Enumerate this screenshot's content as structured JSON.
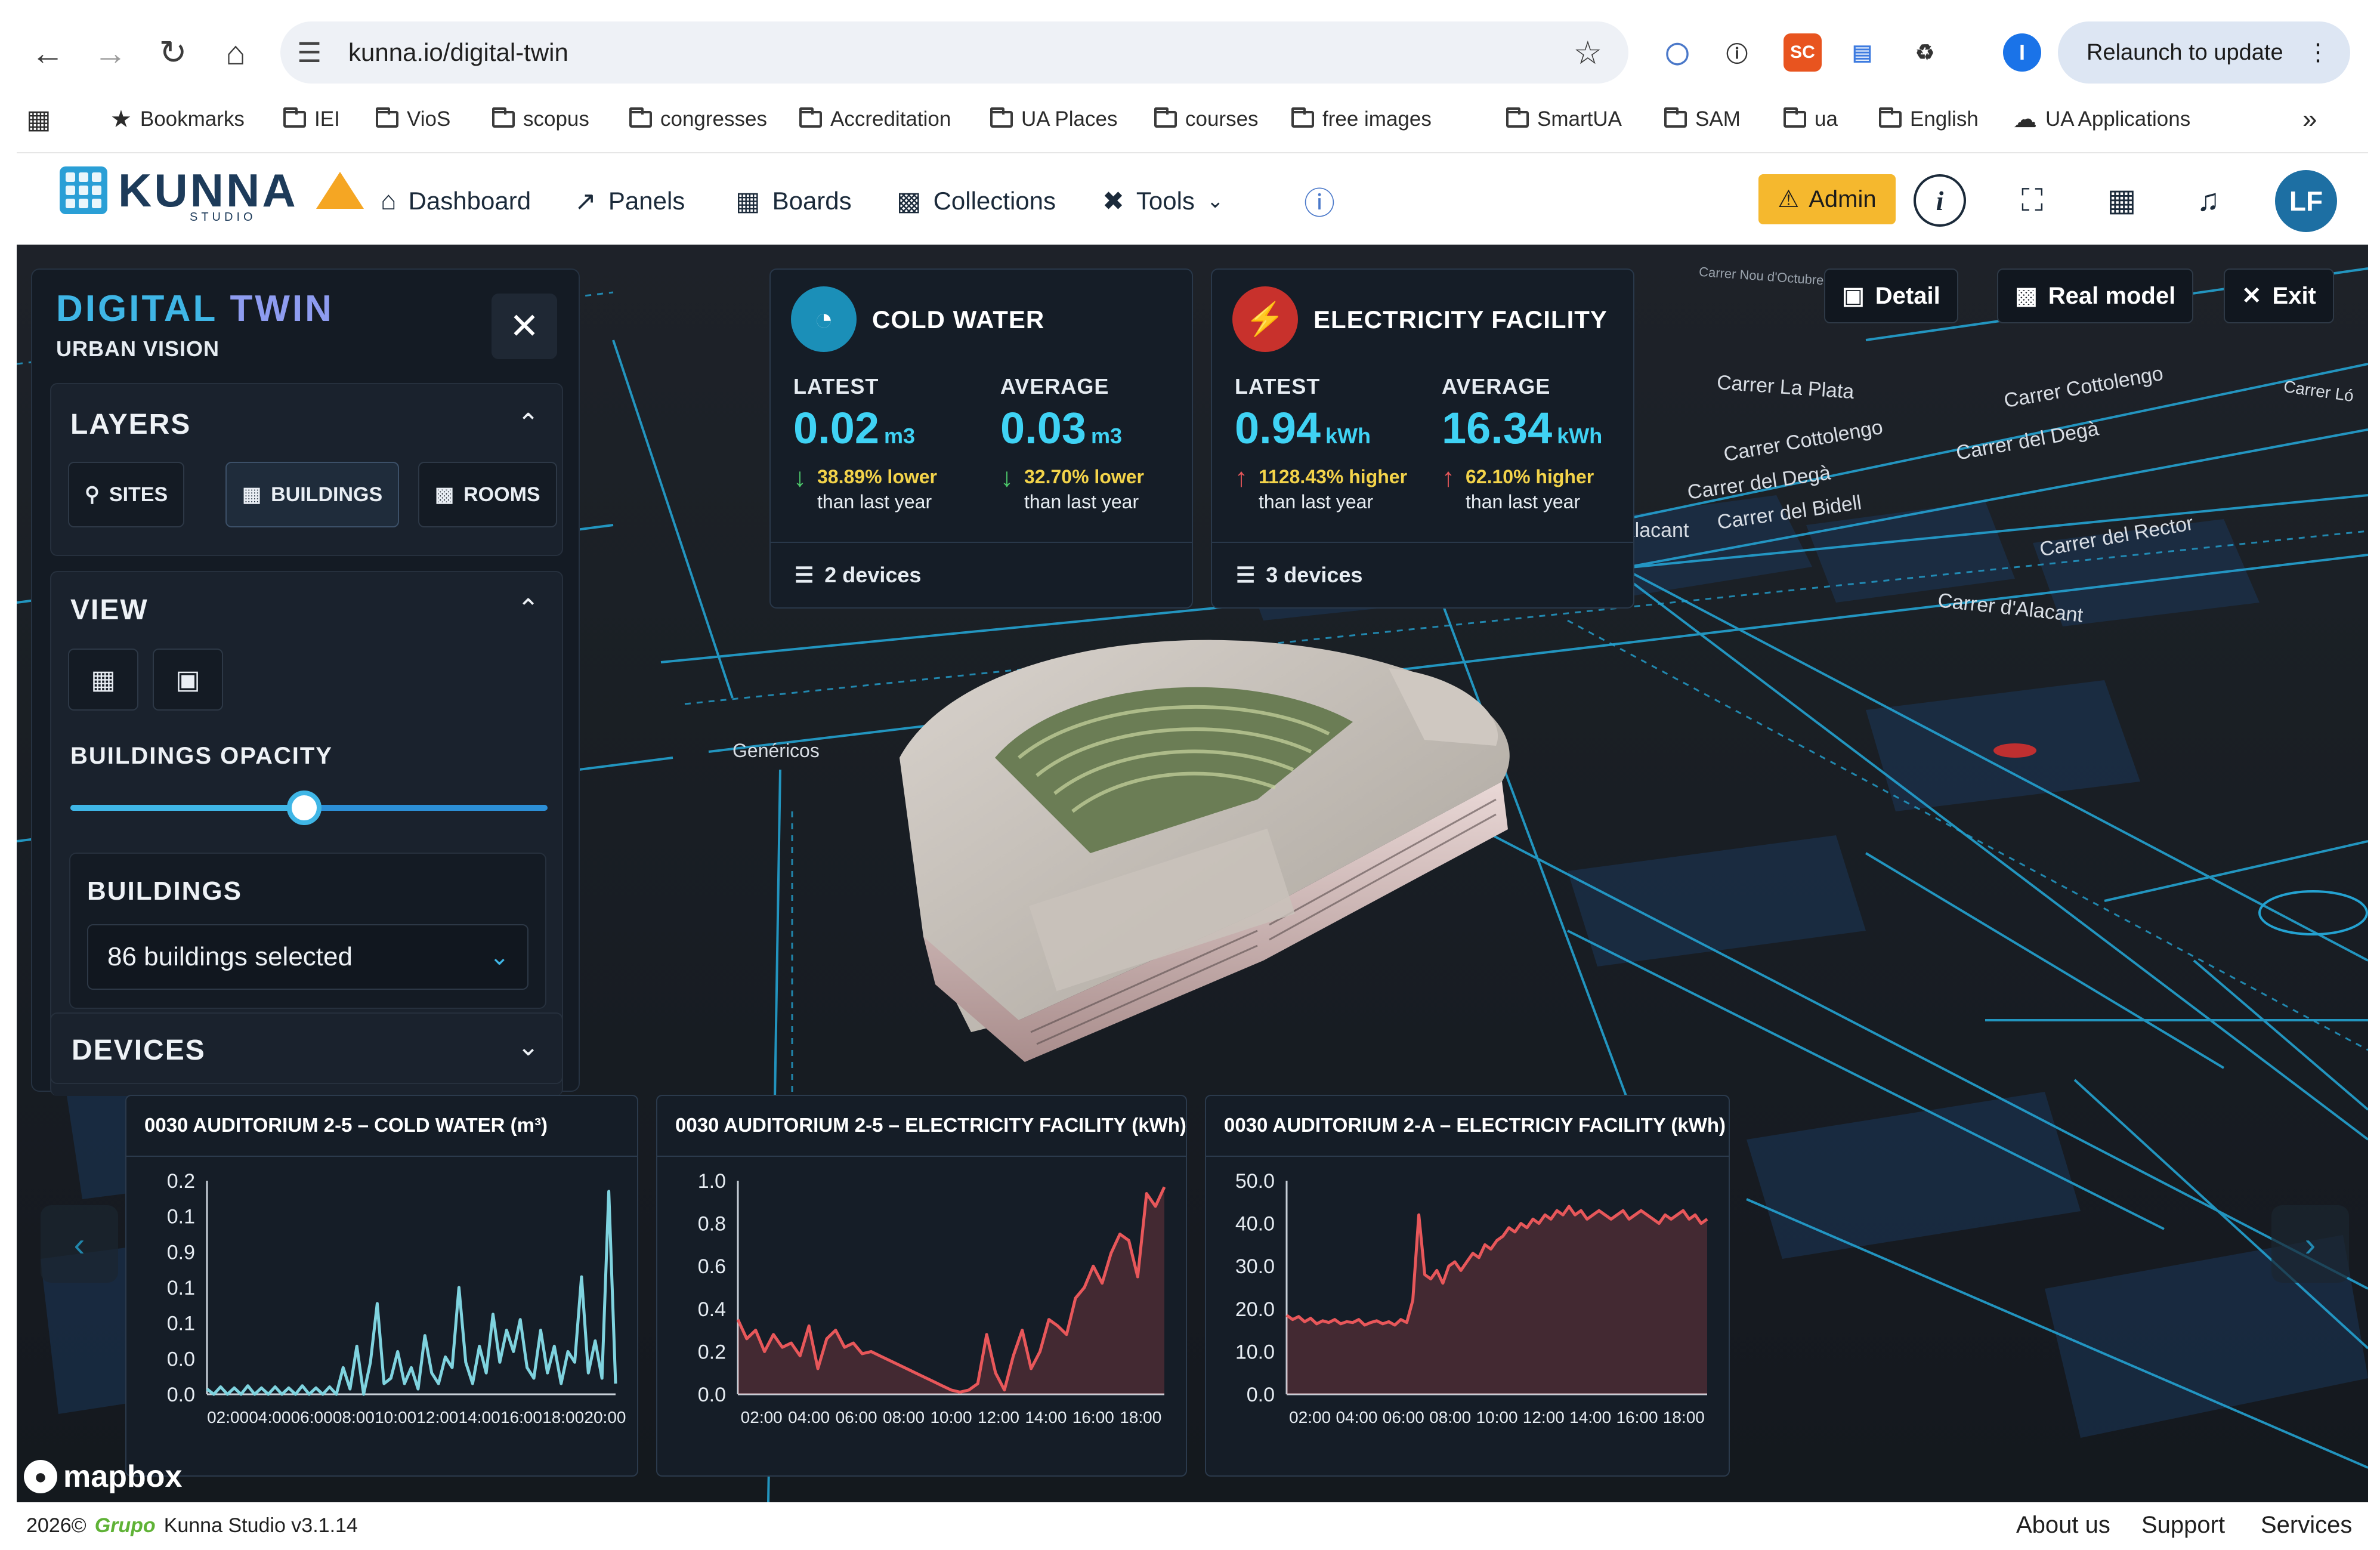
{
  "browser": {
    "url": "kunna.io/digital-twin",
    "relaunch_label": "Relaunch to update",
    "profile_initial": "I",
    "ext_sc": "SC",
    "bookmarks": [
      "Bookmarks",
      "IEI",
      "VioS",
      "scopus",
      "congresses",
      "Accreditation",
      "UA Places",
      "courses",
      "free images",
      "SmartUA",
      "SAM",
      "ua",
      "English",
      "UA Applications"
    ],
    "more_label": "»"
  },
  "app": {
    "logo_text": "KUNNA",
    "logo_sub": "STUDIO",
    "menu": [
      "Dashboard",
      "Panels",
      "Boards",
      "Collections",
      "Tools"
    ],
    "admin_label": "Admin",
    "avatar_initials": "LF",
    "accent": "#3fb6e6"
  },
  "panel": {
    "title_a": "DIGITAL",
    "title_b": "TWIN",
    "subtitle": "URBAN VISION",
    "layers_label": "LAYERS",
    "layer_buttons": [
      "SITES",
      "BUILDINGS",
      "ROOMS"
    ],
    "view_label": "VIEW",
    "opacity_label": "BUILDINGS OPACITY",
    "opacity_value": 0.49,
    "buildings_label": "BUILDINGS",
    "buildings_selected": "86 buildings selected",
    "devices_label": "DEVICES"
  },
  "map": {
    "buttons": [
      "Detail",
      "Real model",
      "Exit"
    ],
    "streets": [
      "Carrer La Plata",
      "Carrer Cottolengo",
      "Carrer Cottolengo",
      "Carrer del Degà",
      "Carrer del Degà",
      "Carrer del Bidell",
      "Alacant",
      "Carrer del Rector",
      "Carrer d'Alacant",
      "Genéricos",
      "Carrer Nou d'Octubre",
      "Carrer Ló"
    ],
    "attribution": "mapbox"
  },
  "kpis": [
    {
      "title": "COLD WATER",
      "icon": "gauge-icon",
      "color": "#1b8fb8",
      "latest_label": "LATEST",
      "latest_value": "0.02",
      "latest_unit": "m3",
      "latest_delta": "38.89% lower",
      "latest_delta_sub": "than last year",
      "average_label": "AVERAGE",
      "average_value": "0.03",
      "average_unit": "m3",
      "average_delta": "32.70% lower",
      "average_delta_sub": "than last year",
      "devices": "2 devices",
      "trend": "down"
    },
    {
      "title": "ELECTRICITY FACILITY",
      "icon": "lightning-icon",
      "color": "#c8312c",
      "latest_label": "LATEST",
      "latest_value": "0.94",
      "latest_unit": "kWh",
      "latest_delta": "1128.43% higher",
      "latest_delta_sub": "than last year",
      "average_label": "AVERAGE",
      "average_value": "16.34",
      "average_unit": "kWh",
      "average_delta": "62.10% higher",
      "average_delta_sub": "than last year",
      "devices": "3 devices",
      "trend": "up"
    }
  ],
  "chart_data": [
    {
      "type": "line",
      "title": "0030 AUDITORIUM 2-5 – COLD WATER (m³)",
      "color": "#7fd3df",
      "x": [
        "02:00",
        "04:00",
        "06:00",
        "08:00",
        "10:00",
        "12:00",
        "14:00",
        "16:00",
        "18:00",
        "20:00"
      ],
      "xrange": [
        1,
        20.5
      ],
      "y_ticks": [
        "0.2",
        "0.1",
        "0.9",
        "0.1",
        "0.1",
        "0.0",
        "0.0"
      ],
      "ylim": [
        0,
        0.2
      ],
      "series": [
        {
          "values": [
            0.005,
            0.0,
            0.007,
            0.0,
            0.006,
            0.0,
            0.008,
            0.0,
            0.006,
            0.0,
            0.007,
            0.0,
            0.006,
            0.0,
            0.008,
            0.0,
            0.006,
            0.0,
            0.007,
            0.0,
            0.025,
            0.005,
            0.045,
            0.0,
            0.03,
            0.085,
            0.01,
            0.015,
            0.04,
            0.01,
            0.025,
            0.005,
            0.055,
            0.02,
            0.01,
            0.035,
            0.025,
            0.1,
            0.03,
            0.01,
            0.045,
            0.02,
            0.075,
            0.03,
            0.06,
            0.04,
            0.07,
            0.025,
            0.015,
            0.06,
            0.02,
            0.045,
            0.01,
            0.04,
            0.03,
            0.11,
            0.02,
            0.05,
            0.015,
            0.19,
            0.01
          ]
        }
      ]
    },
    {
      "type": "area",
      "title": "0030 AUDITORIUM 2-5 – ELECTRICITY FACILITY (kWh)",
      "color": "#e8575a",
      "x": [
        "02:00",
        "04:00",
        "06:00",
        "08:00",
        "10:00",
        "12:00",
        "14:00",
        "16:00",
        "18:00"
      ],
      "xrange": [
        1,
        19
      ],
      "y_ticks": [
        "1.0",
        "0.8",
        "0.6",
        "0.4",
        "0.2",
        "0.0"
      ],
      "ylim": [
        0,
        1.0
      ],
      "series": [
        {
          "values": [
            0.35,
            0.26,
            0.3,
            0.2,
            0.28,
            0.22,
            0.24,
            0.18,
            0.32,
            0.12,
            0.26,
            0.3,
            0.22,
            0.24,
            0.19,
            0.2,
            0.18,
            0.16,
            0.14,
            0.12,
            0.1,
            0.08,
            0.06,
            0.04,
            0.02,
            0.01,
            0.02,
            0.05,
            0.28,
            0.1,
            0.02,
            0.18,
            0.3,
            0.12,
            0.2,
            0.35,
            0.32,
            0.28,
            0.45,
            0.5,
            0.6,
            0.52,
            0.66,
            0.75,
            0.72,
            0.55,
            0.94,
            0.88,
            0.97
          ]
        }
      ]
    },
    {
      "type": "area",
      "title": "0030 AUDITORIUM 2-A – ELECTRICIY FACILITY (kWh)",
      "color": "#e8575a",
      "x": [
        "02:00",
        "04:00",
        "06:00",
        "08:00",
        "10:00",
        "12:00",
        "14:00",
        "16:00",
        "18:00"
      ],
      "xrange": [
        1,
        19
      ],
      "y_ticks": [
        "50.0",
        "40.0",
        "30.0",
        "20.0",
        "10.0",
        "0.0"
      ],
      "ylim": [
        0,
        50
      ],
      "series": [
        {
          "values": [
            18.5,
            17.5,
            18.2,
            17.0,
            17.8,
            16.5,
            17.2,
            16.8,
            17.5,
            16.5,
            17.0,
            16.8,
            17.5,
            16.2,
            16.8,
            17.2,
            16.5,
            17.0,
            16.2,
            17.5,
            16.8,
            22,
            42,
            28,
            27,
            29,
            26,
            30,
            31,
            29,
            31,
            33,
            32,
            35,
            34,
            36,
            37,
            39,
            38,
            40,
            39,
            41,
            40,
            42,
            41,
            43,
            42,
            44,
            42,
            43,
            41,
            42,
            43,
            42,
            41,
            42,
            43,
            41,
            42,
            43,
            42,
            41,
            40,
            42,
            41,
            42,
            43,
            41,
            42,
            40,
            41
          ]
        }
      ]
    }
  ],
  "footer": {
    "year": "2026©",
    "brand": "Grupo",
    "version": "Kunna Studio v3.1.14",
    "links": [
      "About us",
      "Support",
      "Services"
    ]
  }
}
